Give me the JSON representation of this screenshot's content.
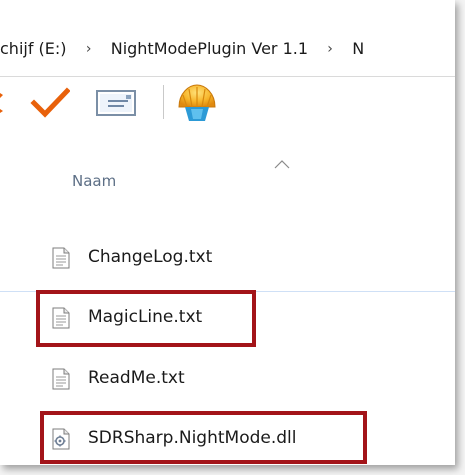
{
  "address_bar": {
    "crumbs": [
      "chijf (E:)",
      "NightModePlugin Ver 1.1",
      "N"
    ],
    "separator": "›"
  },
  "toolbar": {
    "icons": [
      "check-icon",
      "envelope-icon",
      "shell-icon"
    ]
  },
  "column_header": {
    "name_label": "Naam",
    "sort": "ascending"
  },
  "files": [
    {
      "name": "ChangeLog.txt",
      "icon": "text-file-icon",
      "highlighted": false
    },
    {
      "name": "MagicLine.txt",
      "icon": "text-file-icon",
      "highlighted": true
    },
    {
      "name": "ReadMe.txt",
      "icon": "text-file-icon",
      "highlighted": false
    },
    {
      "name": "SDRSharp.NightMode.dll",
      "icon": "dll-file-icon",
      "highlighted": true
    }
  ],
  "colors": {
    "highlight_border": "#a31419",
    "check_orange": "#e8610b",
    "header_text": "#5d6f86"
  }
}
